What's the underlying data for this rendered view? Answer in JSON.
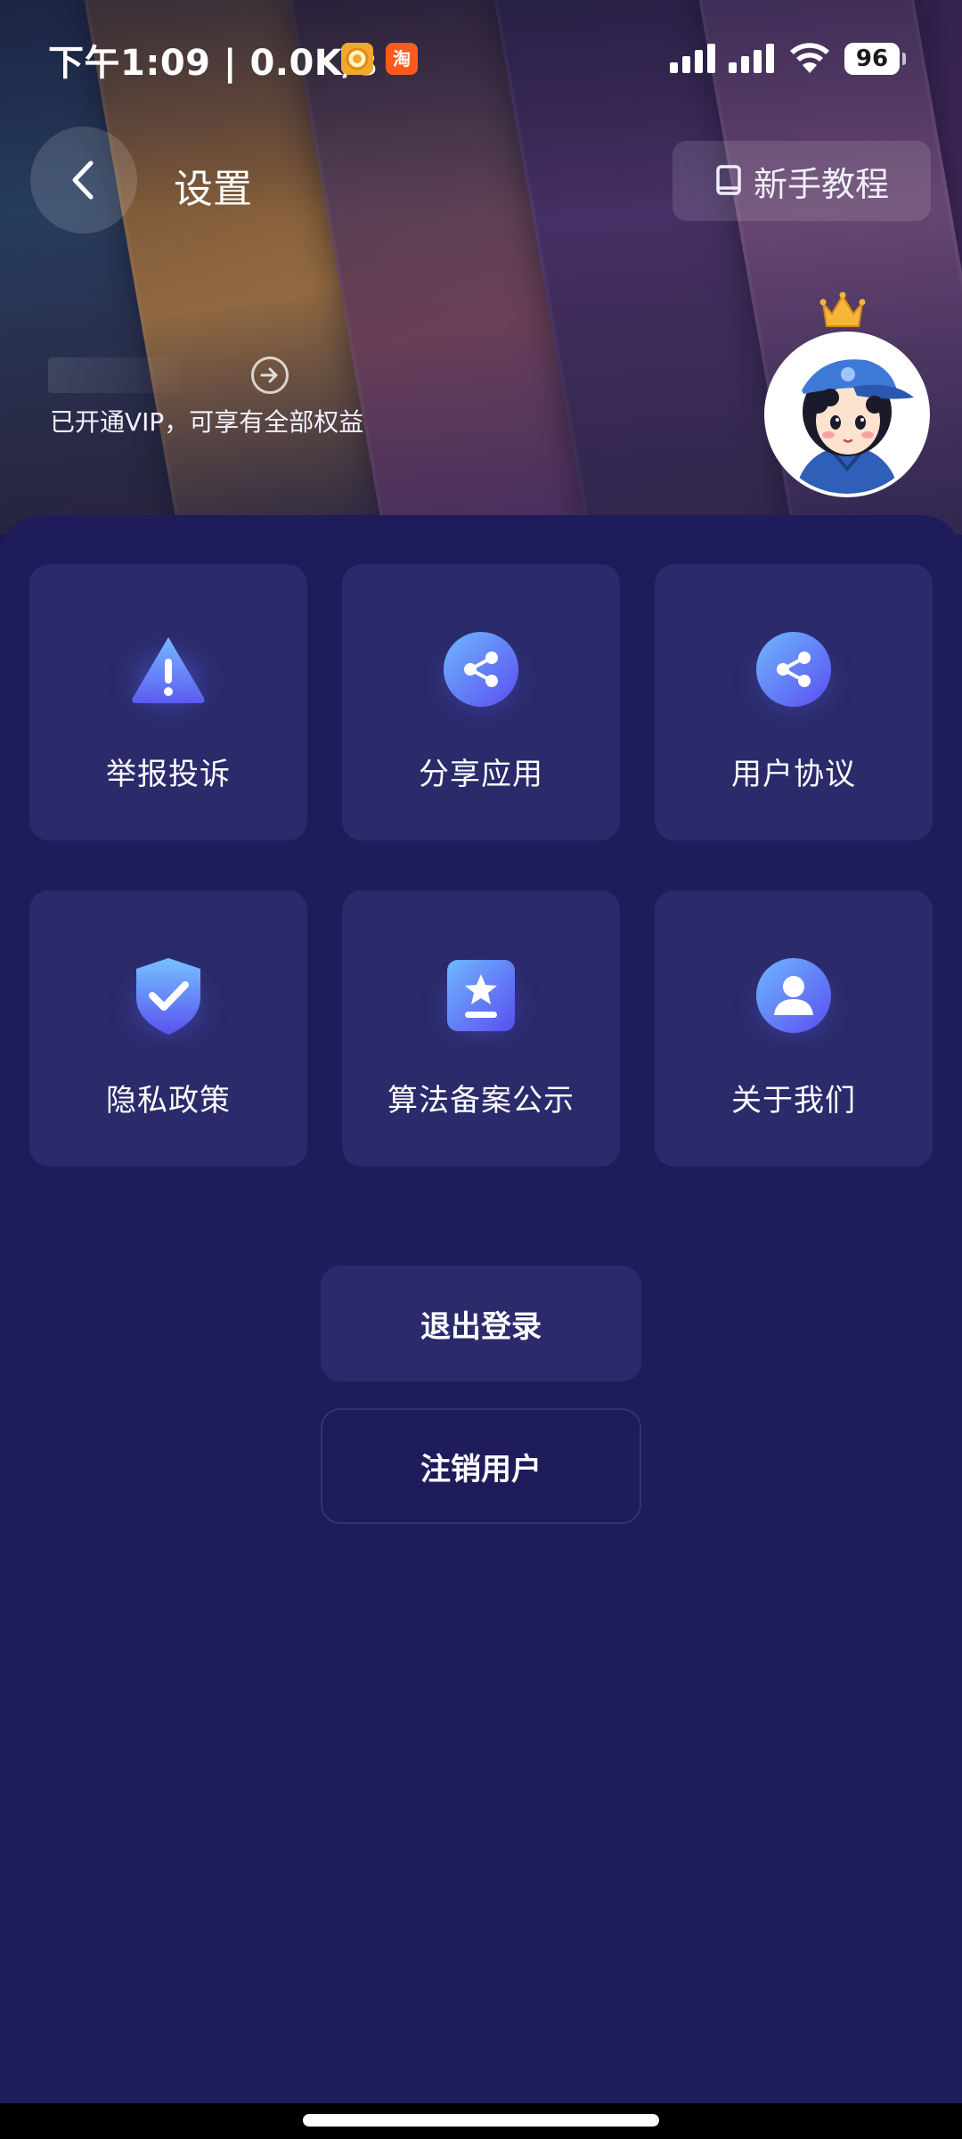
{
  "status_bar": {
    "time_and_speed": "下午1:09 | 0.0K/s",
    "app_icon_1": "coin-app-icon",
    "app_icon_2": "淘",
    "battery": "96"
  },
  "header": {
    "back_icon": "chevron-left-icon",
    "title": "设置",
    "tutorial_icon": "book-icon",
    "tutorial_label": "新手教程"
  },
  "user": {
    "vip_text": "已开通VIP，可享有全部权益",
    "avatar": "cartoon-boy-avatar",
    "badge": "crown-icon"
  },
  "grid": {
    "items": [
      {
        "label": "举报投诉",
        "icon": "warning-icon"
      },
      {
        "label": "分享应用",
        "icon": "share-icon"
      },
      {
        "label": "用户协议",
        "icon": "share-icon"
      },
      {
        "label": "隐私政策",
        "icon": "shield-check-icon"
      },
      {
        "label": "算法备案公示",
        "icon": "star-badge-icon"
      },
      {
        "label": "关于我们",
        "icon": "user-icon"
      }
    ]
  },
  "actions": {
    "logout_label": "退出登录",
    "cancel_account_label": "注销用户"
  },
  "colors": {
    "background": "#1c1a56",
    "tile": "#2b2a6b",
    "accent": "#5d6bff"
  }
}
